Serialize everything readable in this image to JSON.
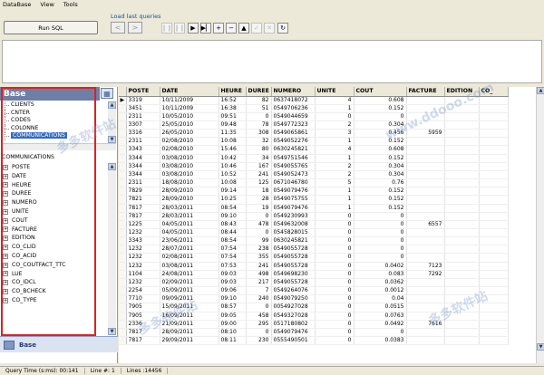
{
  "menu": [
    "DataBase",
    "View",
    "Tools"
  ],
  "toolbar": {
    "run_sql": "Run SQL",
    "load_last_queries": "Load last queries",
    "prev": "<",
    "next": ">",
    "nav": [
      "❙❙",
      "❙❙",
      "▶",
      "▶▏",
      "+",
      "−",
      "▲",
      "✓",
      "✕",
      "↻"
    ]
  },
  "sidebar": {
    "header": "Base",
    "tables": [
      "CLIENTS",
      "CNTER",
      "CODES",
      "COLONNE",
      "COMMUNICATIONS"
    ],
    "selected_table": "COMMUNICATIONS",
    "structure_title": "COMMUNICATIONS",
    "fields": [
      "POSTE",
      "DATE",
      "HEURE",
      "DUREE",
      "NUMERO",
      "UNITE",
      "COUT",
      "FACTURE",
      "EDITION",
      "CO_CLID",
      "CO_ACID",
      "CO_COUTFACT_TTC",
      "LUE",
      "CO_IDCL",
      "CO_BCHECK",
      "CO_TYPE"
    ],
    "bottom_tab": "Base"
  },
  "grid": {
    "columns": [
      "POSTE",
      "DATE",
      "HEURE",
      "DUREE",
      "NUMERO",
      "UNITE",
      "COUT",
      "FACTURE",
      "EDITION",
      "CO_"
    ],
    "rows": [
      [
        "3319",
        "10/11/2009",
        "16:52",
        "82",
        "0637418072",
        "4",
        "0.608",
        "",
        ""
      ],
      [
        "3451",
        "10/11/2009",
        "16:38",
        "51",
        "0549706236",
        "1",
        "0.152",
        "",
        ""
      ],
      [
        "2311",
        "10/05/2010",
        "09:51",
        "0",
        "0549044659",
        "0",
        "0",
        "",
        ""
      ],
      [
        "3307",
        "25/05/2010",
        "09:48",
        "78",
        "0549772323",
        "2",
        "0.304",
        "",
        ""
      ],
      [
        "3316",
        "26/05/2010",
        "11:35",
        "308",
        "0549065861",
        "3",
        "0.456",
        "5959",
        ""
      ],
      [
        "2311",
        "02/08/2010",
        "10:08",
        "32",
        "0549052276",
        "1",
        "0.152",
        "",
        ""
      ],
      [
        "3343",
        "02/08/2010",
        "15:46",
        "80",
        "0630245821",
        "4",
        "0.608",
        "",
        ""
      ],
      [
        "3344",
        "03/08/2010",
        "10:42",
        "34",
        "0549751546",
        "1",
        "0.152",
        "",
        ""
      ],
      [
        "3344",
        "03/08/2010",
        "10:46",
        "167",
        "0549055765",
        "2",
        "0.304",
        "",
        ""
      ],
      [
        "3344",
        "03/08/2010",
        "10:52",
        "241",
        "0549052473",
        "2",
        "0.304",
        "",
        ""
      ],
      [
        "2311",
        "18/08/2010",
        "10:08",
        "125",
        "0671046780",
        "5",
        "0.76",
        "",
        ""
      ],
      [
        "7829",
        "28/09/2010",
        "09:14",
        "18",
        "0549079476",
        "1",
        "0.152",
        "",
        ""
      ],
      [
        "7821",
        "28/09/2010",
        "10:25",
        "28",
        "0549075755",
        "1",
        "0.152",
        "",
        ""
      ],
      [
        "7817",
        "28/03/2011",
        "08:54",
        "19",
        "0549079476",
        "1",
        "0.152",
        "",
        ""
      ],
      [
        "7817",
        "28/03/2011",
        "09:10",
        "0",
        "0549230993",
        "0",
        "0",
        "",
        ""
      ],
      [
        "1225",
        "04/05/2011",
        "08:43",
        "478",
        "0549632008",
        "0",
        "0",
        "6557",
        ""
      ],
      [
        "1232",
        "04/05/2011",
        "08:44",
        "0",
        "0545828015",
        "0",
        "0",
        "",
        ""
      ],
      [
        "3343",
        "23/06/2011",
        "08:54",
        "99",
        "0630245821",
        "0",
        "0",
        "",
        ""
      ],
      [
        "1232",
        "28/07/2011",
        "07:54",
        "238",
        "0549055728",
        "0",
        "0",
        "",
        ""
      ],
      [
        "1232",
        "02/08/2011",
        "07:54",
        "355",
        "0549055728",
        "0",
        "0",
        "",
        ""
      ],
      [
        "1232",
        "03/08/2011",
        "07:53",
        "241",
        "0549055728",
        "0",
        "0.0402",
        "7123",
        ""
      ],
      [
        "1104",
        "24/08/2011",
        "09:03",
        "498",
        "0549698230",
        "0",
        "0.083",
        "7292",
        ""
      ],
      [
        "1232",
        "02/09/2011",
        "09:03",
        "217",
        "0549055728",
        "0",
        "0.0362",
        "",
        ""
      ],
      [
        "2254",
        "05/09/2011",
        "09:06",
        "7",
        "0549264076",
        "0",
        "0.0012",
        "",
        ""
      ],
      [
        "7710",
        "09/09/2011",
        "09:10",
        "240",
        "0549079250",
        "0",
        "0.04",
        "",
        ""
      ],
      [
        "7905",
        "15/09/2011",
        "08:57",
        "0",
        "0054927028",
        "0",
        "0.0515",
        "",
        ""
      ],
      [
        "7905",
        "16/09/2011",
        "09:05",
        "458",
        "0549327028",
        "0",
        "0.0763",
        "",
        ""
      ],
      [
        "2336",
        "21/09/2011",
        "09:00",
        "295",
        "0517180802",
        "0",
        "0.0492",
        "7616",
        ""
      ],
      [
        "7817",
        "28/09/2011",
        "08:10",
        "0",
        "0549079476",
        "0",
        "0",
        "",
        ""
      ],
      [
        "7817",
        "29/09/2011",
        "08:11",
        "230",
        "0555490501",
        "0",
        "0.0383",
        "",
        ""
      ]
    ]
  },
  "status": {
    "query_time": "Query Time (s:ms): 00:141",
    "line": "Line #: 1",
    "lines": "Lines :14456"
  }
}
